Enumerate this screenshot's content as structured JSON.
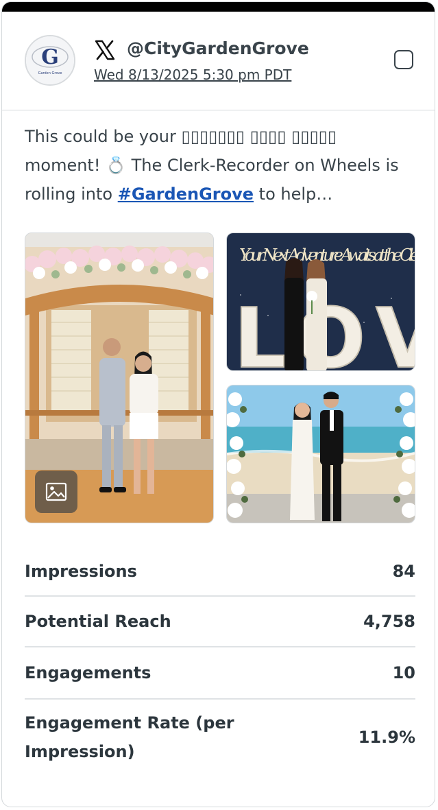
{
  "post": {
    "network": "X",
    "handle": "@CityGardenGrove",
    "timestamp": "Wed 8/13/2025 5:30 pm PDT",
    "avatar_text": "G",
    "avatar_subtext": "Garden Grove",
    "text_before": "This could be your ▯▯▯▯▯▯▯ ▯▯▯▯ ▯▯▯▯▯ moment! 💍 The Clerk-Recorder on Wheels is rolling into ",
    "hashtag": "#GardenGrove",
    "text_after": " to help…",
    "photo2_sign_text": "Your Next Adventure Awaits at the Clerk-Re",
    "photo2_letters": "LOV"
  },
  "stats": [
    {
      "label": "Impressions",
      "value": "84"
    },
    {
      "label": "Potential Reach",
      "value": "4,758"
    },
    {
      "label": "Engagements",
      "value": "10"
    },
    {
      "label": "Engagement Rate (per Impression)",
      "value": "11.9%"
    }
  ],
  "colors": {
    "text": "#39434a",
    "hashtag": "#1a56b5",
    "divider": "#dfe2e5",
    "topbar": "#000000"
  },
  "icons": [
    "x-logo-icon",
    "checkbox-icon",
    "image-gallery-icon"
  ]
}
